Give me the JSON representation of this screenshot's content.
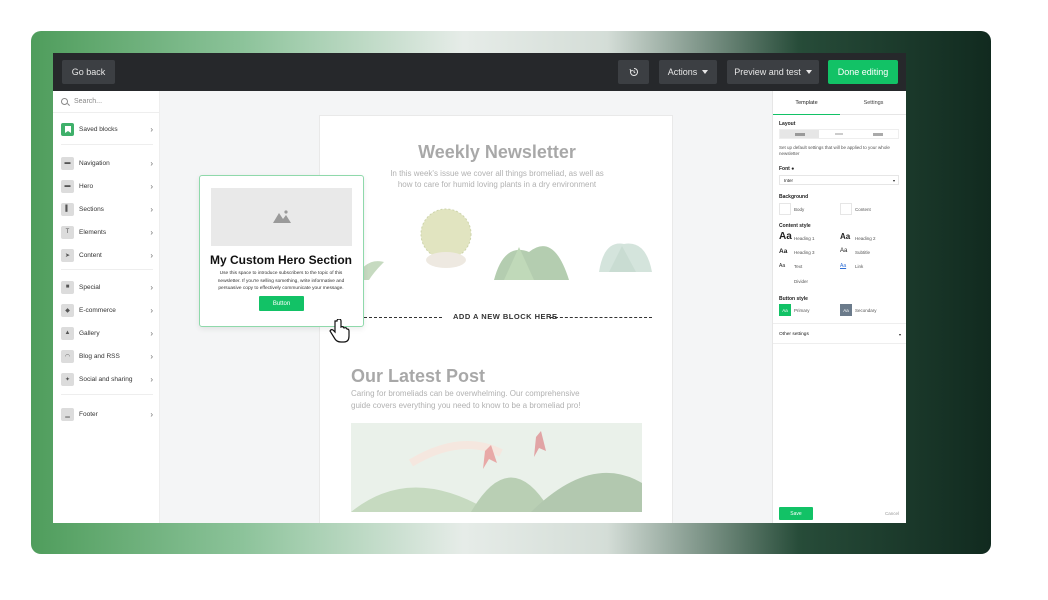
{
  "topbar": {
    "go_back": "Go back",
    "actions": "Actions",
    "preview": "Preview and test",
    "done": "Done editing"
  },
  "sidebar": {
    "search_placeholder": "Search...",
    "items": [
      {
        "label": "Saved blocks",
        "icon": "bookmark-icon"
      },
      {
        "label": "Navigation",
        "icon": "navigation-icon"
      },
      {
        "label": "Hero",
        "icon": "hero-icon"
      },
      {
        "label": "Sections",
        "icon": "sections-icon"
      },
      {
        "label": "Elements",
        "icon": "text-icon"
      },
      {
        "label": "Content",
        "icon": "cursor-icon"
      },
      {
        "label": "Special",
        "icon": "special-icon"
      },
      {
        "label": "E-commerce",
        "icon": "tag-icon"
      },
      {
        "label": "Gallery",
        "icon": "image-icon"
      },
      {
        "label": "Blog and RSS",
        "icon": "rss-icon"
      },
      {
        "label": "Social and sharing",
        "icon": "twitter-icon"
      },
      {
        "label": "Footer",
        "icon": "footer-icon"
      }
    ]
  },
  "newsletter": {
    "title": "Weekly Newsletter",
    "subtitle_line1": "In this week's issue we cover all things bromeliad, as well as",
    "subtitle_line2": "how to care for humid loving plants in a dry environment",
    "add_block": "ADD A NEW BLOCK HERE",
    "post_title": "Our Latest Post",
    "post_line1": "Caring for bromeliads can be overwhelming. Our comprehensive",
    "post_line2": "guide covers everything you need to know to be a bromeliad pro!"
  },
  "popup": {
    "title": "My Custom Hero Section",
    "line1": "Use this space to introduce subscribers to the topic of this",
    "line2": "newsletter. If you're selling something, write informative and",
    "line3": "persuasive copy to effectively communicate your message.",
    "button": "Button"
  },
  "rpanel": {
    "tab_template": "Template",
    "tab_settings": "Settings",
    "layout": "Layout",
    "layout_desc1": "Set up default settings that will be applied to your whole",
    "layout_desc2": "newsletter",
    "font": "Font",
    "font_value": "Inter",
    "background": "Background",
    "bg_body": "Body",
    "bg_content": "Content",
    "content_style": "Content style",
    "heading1": "Heading 1",
    "heading2": "Heading 2",
    "heading3": "Heading 3",
    "subtitle": "Subtitle",
    "text": "Text",
    "link": "Link",
    "divider": "Divider",
    "aa": "Aa",
    "button_style": "Button style",
    "primary": "Primary",
    "secondary": "Secondary",
    "other_settings": "Other settings",
    "save": "Save",
    "cancel": "Cancel"
  },
  "colors": {
    "accent": "#12c266",
    "topbar": "#26282b"
  }
}
